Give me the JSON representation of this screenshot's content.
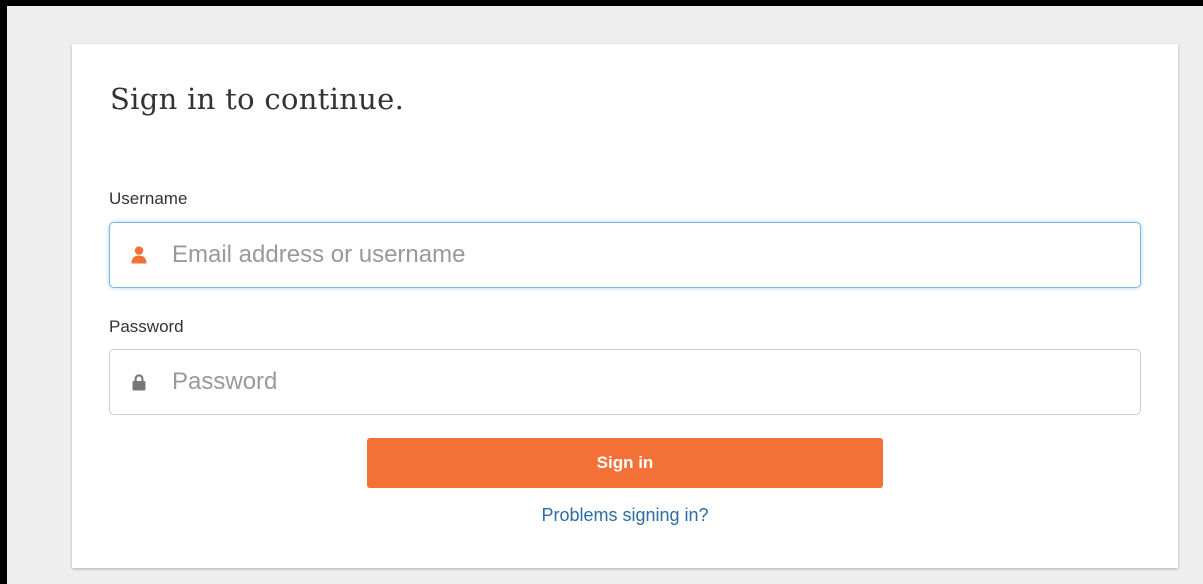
{
  "signin": {
    "title": "Sign in to continue.",
    "username": {
      "label": "Username",
      "value": "",
      "placeholder": "Email address or username",
      "icon": "user-icon",
      "icon_color": "#f37037"
    },
    "password": {
      "label": "Password",
      "value": "",
      "placeholder": "Password",
      "icon": "lock-icon",
      "icon_color": "#777777"
    },
    "submit_label": "Sign in",
    "problems_link": "Problems signing in?"
  },
  "colors": {
    "accent": "#f37037",
    "link": "#2d6da3",
    "focus_border": "#7eb6e6",
    "page_background": "#eeeeee"
  }
}
